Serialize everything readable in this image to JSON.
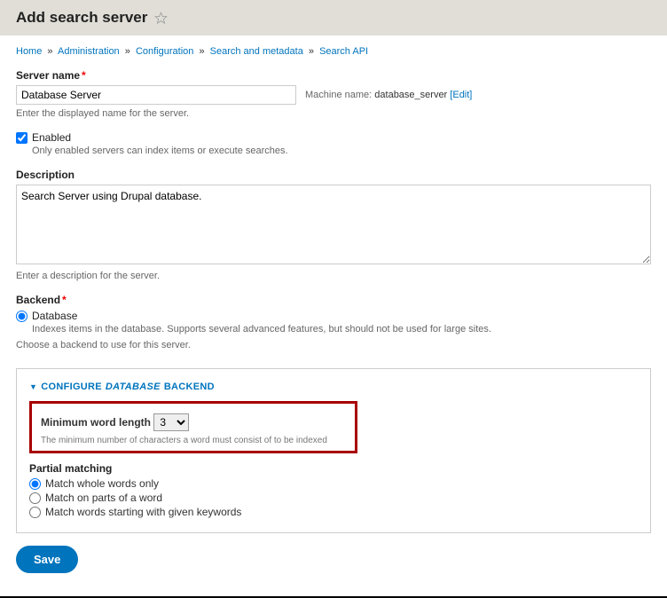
{
  "header": {
    "title": "Add search server"
  },
  "breadcrumb": {
    "items": [
      "Home",
      "Administration",
      "Configuration",
      "Search and metadata",
      "Search API"
    ],
    "sep": "»"
  },
  "form": {
    "server_name": {
      "label": "Server name",
      "value": "Database Server",
      "help": "Enter the displayed name for the server.",
      "machine_label": "Machine name:",
      "machine_value": "database_server",
      "edit_link": "[Edit]"
    },
    "enabled": {
      "label": "Enabled",
      "checked": true,
      "help": "Only enabled servers can index items or execute searches."
    },
    "description": {
      "label": "Description",
      "value": "Search Server using Drupal database.",
      "help": "Enter a description for the server."
    },
    "backend": {
      "label": "Backend",
      "option": "Database",
      "option_help": "Indexes items in the database. Supports several advanced features, but should not be used for large sites.",
      "help": "Choose a backend to use for this server."
    },
    "fieldset": {
      "legend_prefix": "CONFIGURE",
      "legend_em": "DATABASE",
      "legend_suffix": "BACKEND",
      "min_word": {
        "label": "Minimum word length",
        "value": "3",
        "help": "The minimum number of characters a word must consist of to be indexed"
      },
      "partial": {
        "label": "Partial matching",
        "options": [
          "Match whole words only",
          "Match on parts of a word",
          "Match words starting with given keywords"
        ],
        "selected": 0
      }
    },
    "save_label": "Save"
  }
}
